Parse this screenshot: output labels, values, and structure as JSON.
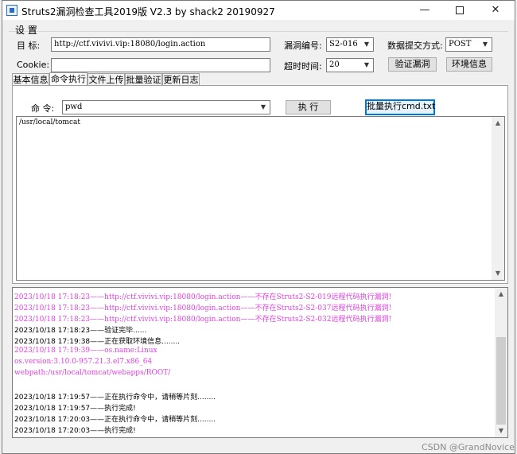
{
  "window": {
    "title": "Struts2漏洞检查工具2019版 V2.3 by shack2 20190927",
    "minimize_glyph": "—",
    "close_glyph": "✕"
  },
  "settings": {
    "group_label": "设 置",
    "target_label": "目  标:",
    "target_value": "http://ctf.vivivi.vip:18080/login.action",
    "cookie_label": "Cookie:",
    "cookie_value": "",
    "vuln_id_label": "漏洞编号:",
    "vuln_id_value": "S2-016",
    "submit_method_label": "数据提交方式:",
    "submit_method_value": "POST",
    "timeout_label": "超时时间:",
    "timeout_value": "20",
    "verify_button": "验证漏洞",
    "env_button": "环境信息"
  },
  "tabs": [
    {
      "label": "基本信息",
      "active": false
    },
    {
      "label": "命令执行",
      "active": true
    },
    {
      "label": "文件上传",
      "active": false
    },
    {
      "label": "批量验证",
      "active": false
    },
    {
      "label": "更新日志",
      "active": false
    }
  ],
  "command": {
    "label": "命  令:",
    "value": "pwd",
    "execute_button": "执  行",
    "batch_button": "批量执行cmd.txt",
    "output": "/usr/local/tomcat"
  },
  "log": [
    {
      "text": "2023/10/18 17:18:23——http://ctf.vivivi.vip:18080/login.action——不存在Struts2-S2-019远程代码执行漏洞!",
      "color": "pink"
    },
    {
      "text": "2023/10/18 17:18:23——http://ctf.vivivi.vip:18080/login.action——不存在Struts2-S2-037远程代码执行漏洞!",
      "color": "pink"
    },
    {
      "text": "2023/10/18 17:18:23——http://ctf.vivivi.vip:18080/login.action——不存在Struts2-S2-032远程代码执行漏洞!",
      "color": "pink"
    },
    {
      "text": "2023/10/18 17:18:23——验证完毕......",
      "color": "black"
    },
    {
      "text": "2023/10/18 17:19:38——正在获取环境信息........",
      "color": "black"
    },
    {
      "text": "2023/10/18 17:19:39——os.name:Linux",
      "color": "pink"
    },
    {
      "text": "os.version:3.10.0-957.21.3.el7.x86_64",
      "color": "pink"
    },
    {
      "text": "webpath:/usr/local/tomcat/webapps/ROOT/",
      "color": "pink"
    },
    {
      "text": "",
      "color": "black"
    },
    {
      "text": "2023/10/18 17:19:57——正在执行命令中，请稍等片刻........",
      "color": "black"
    },
    {
      "text": "2023/10/18 17:19:57——执行完成!",
      "color": "black"
    },
    {
      "text": "2023/10/18 17:20:03——正在执行命令中，请稍等片刻........",
      "color": "black"
    },
    {
      "text": "2023/10/18 17:20:03——执行完成!",
      "color": "black"
    }
  ],
  "watermark": "CSDN @GrandNovice",
  "colors": {
    "log_pink": "#e040e0",
    "focus_blue": "#0078d7"
  }
}
